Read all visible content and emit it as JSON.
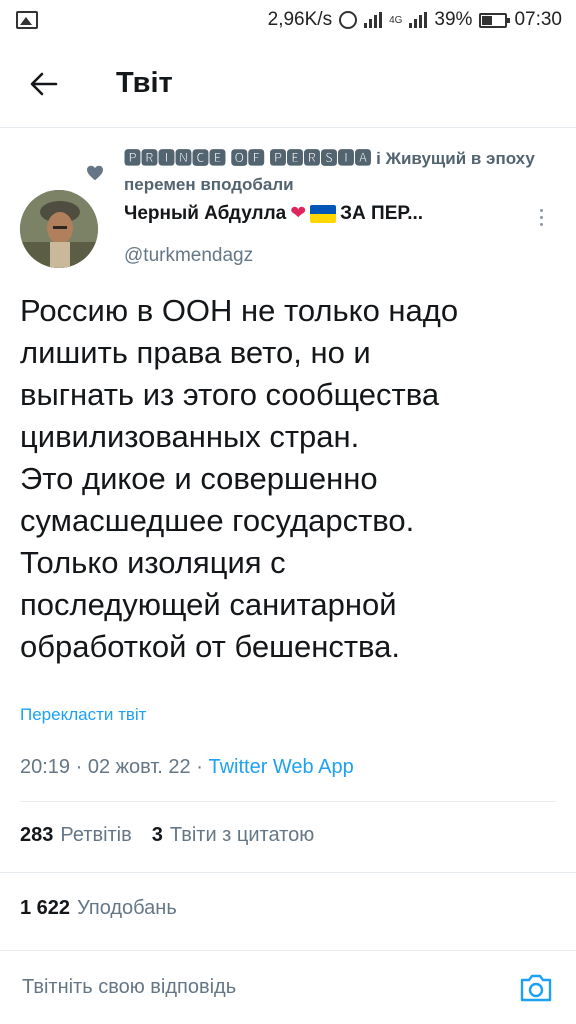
{
  "status_bar": {
    "speed": "2,96K/s",
    "net_type": "4G",
    "battery": "39%",
    "battery_level": 0.39,
    "time": "07:30"
  },
  "header": {
    "title": "Твіт"
  },
  "social_context": {
    "text": "🅿🆁🅸🅽🅲🅴 🅾🅵 🅿🅴🆁🆂🅸🅰 і Живущий в эпоху перемен вподобали"
  },
  "author": {
    "name": "Черный Абдулла",
    "heart": "❤",
    "name_suffix": "ЗА ПЕР...",
    "handle": "@turkmendagz"
  },
  "tweet": {
    "text": "Россию в ООН не только надо\nлишить права вето, но и\nвыгнать из этого сообщества\nцивилизованных стран.\nЭто дикое и совершенно\nсумасшедшее государство.\nТолько изоляция с\nпоследующей санитарной\nобработкой от бешенства.",
    "translate": "Перекласти твіт",
    "time": "20:19",
    "date": "02 жовт. 22",
    "separator": "·",
    "source": "Twitter Web App"
  },
  "stats": {
    "retweets_count": "283",
    "retweets_label": "Ретвітів",
    "quotes_count": "3",
    "quotes_label": "Твіти з цитатою",
    "likes_count": "1 622",
    "likes_label": "Уподобань"
  },
  "reply": {
    "placeholder": "Твітніть свою відповідь"
  },
  "colors": {
    "link": "#1da1f2",
    "secondary": "#657786",
    "heart": "#e0245e",
    "flag_blue": "#0057b7",
    "flag_yellow": "#ffd700"
  },
  "icons": [
    "image-icon",
    "alarm-icon",
    "signal-icon",
    "battery-icon",
    "back-arrow-icon",
    "heart-icon",
    "more-icon",
    "camera-icon"
  ]
}
